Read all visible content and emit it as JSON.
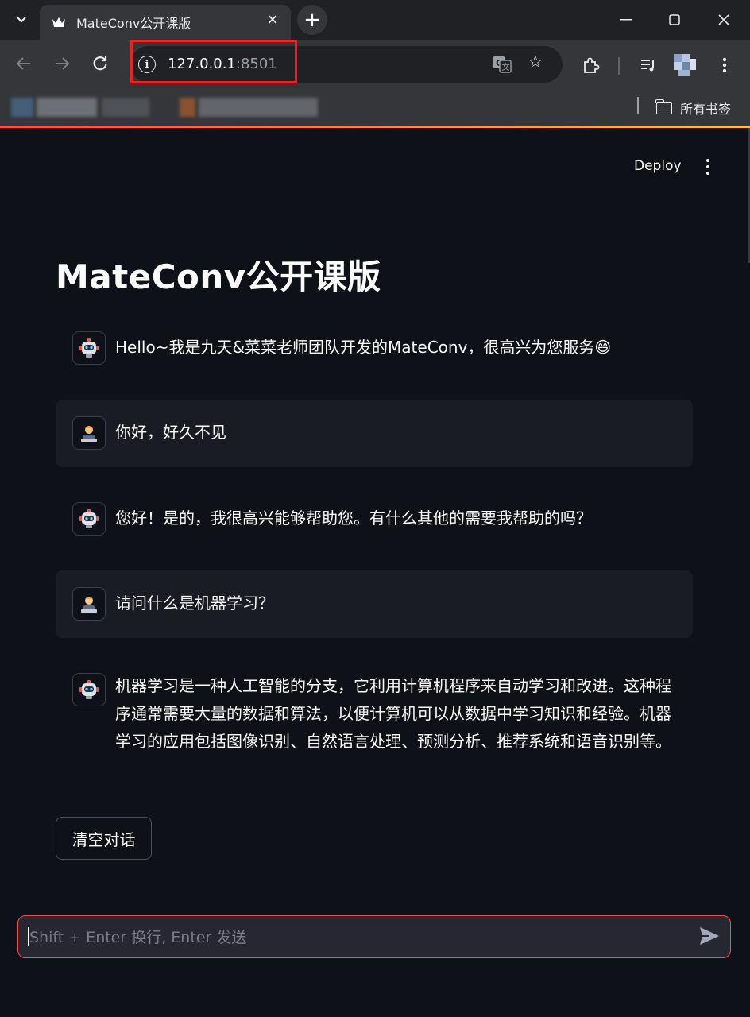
{
  "browser": {
    "tab_title": "MateConv公开课版",
    "url_host": "127.0.0.1",
    "url_port": ":8501",
    "bookmarks_all_label": "所有书签",
    "icons": [
      "tab-search-icon",
      "crown-favicon-icon",
      "close-icon",
      "plus-icon",
      "minimize-icon",
      "maximize-icon",
      "window-close-icon",
      "back-icon",
      "forward-icon",
      "reload-icon",
      "info-icon",
      "translate-icon",
      "star-icon",
      "extensions-icon",
      "media-icon",
      "profile-avatar",
      "more-vert-icon",
      "folder-icon"
    ]
  },
  "app": {
    "header": {
      "deploy_label": "Deploy"
    },
    "title": "MateConv公开课版",
    "messages": [
      {
        "role": "assistant",
        "text": "Hello~我是九天&菜菜老师团队开发的MateConv，很高兴为您服务😄"
      },
      {
        "role": "user",
        "text": "你好，好久不见"
      },
      {
        "role": "assistant",
        "text": "您好！是的，我很高兴能够帮助您。有什么其他的需要我帮助的吗？"
      },
      {
        "role": "user",
        "text": "请问什么是机器学习？"
      },
      {
        "role": "assistant",
        "text": "机器学习是一种人工智能的分支，它利用计算机程序来自动学习和改进。这种程序通常需要大量的数据和算法，以便计算机可以从数据中学习知识和经验。机器学习的应用包括图像识别、自然语言处理、预测分析、推荐系统和语音识别等。"
      }
    ],
    "clear_button_label": "清空对话",
    "chat_input": {
      "placeholder": "Shift + Enter 换行, Enter 发送",
      "value": ""
    },
    "colors": {
      "accent": "#ff4b4b",
      "background": "#0e1117",
      "user_bubble": "#1a1c24",
      "input_bg": "#262730"
    }
  }
}
